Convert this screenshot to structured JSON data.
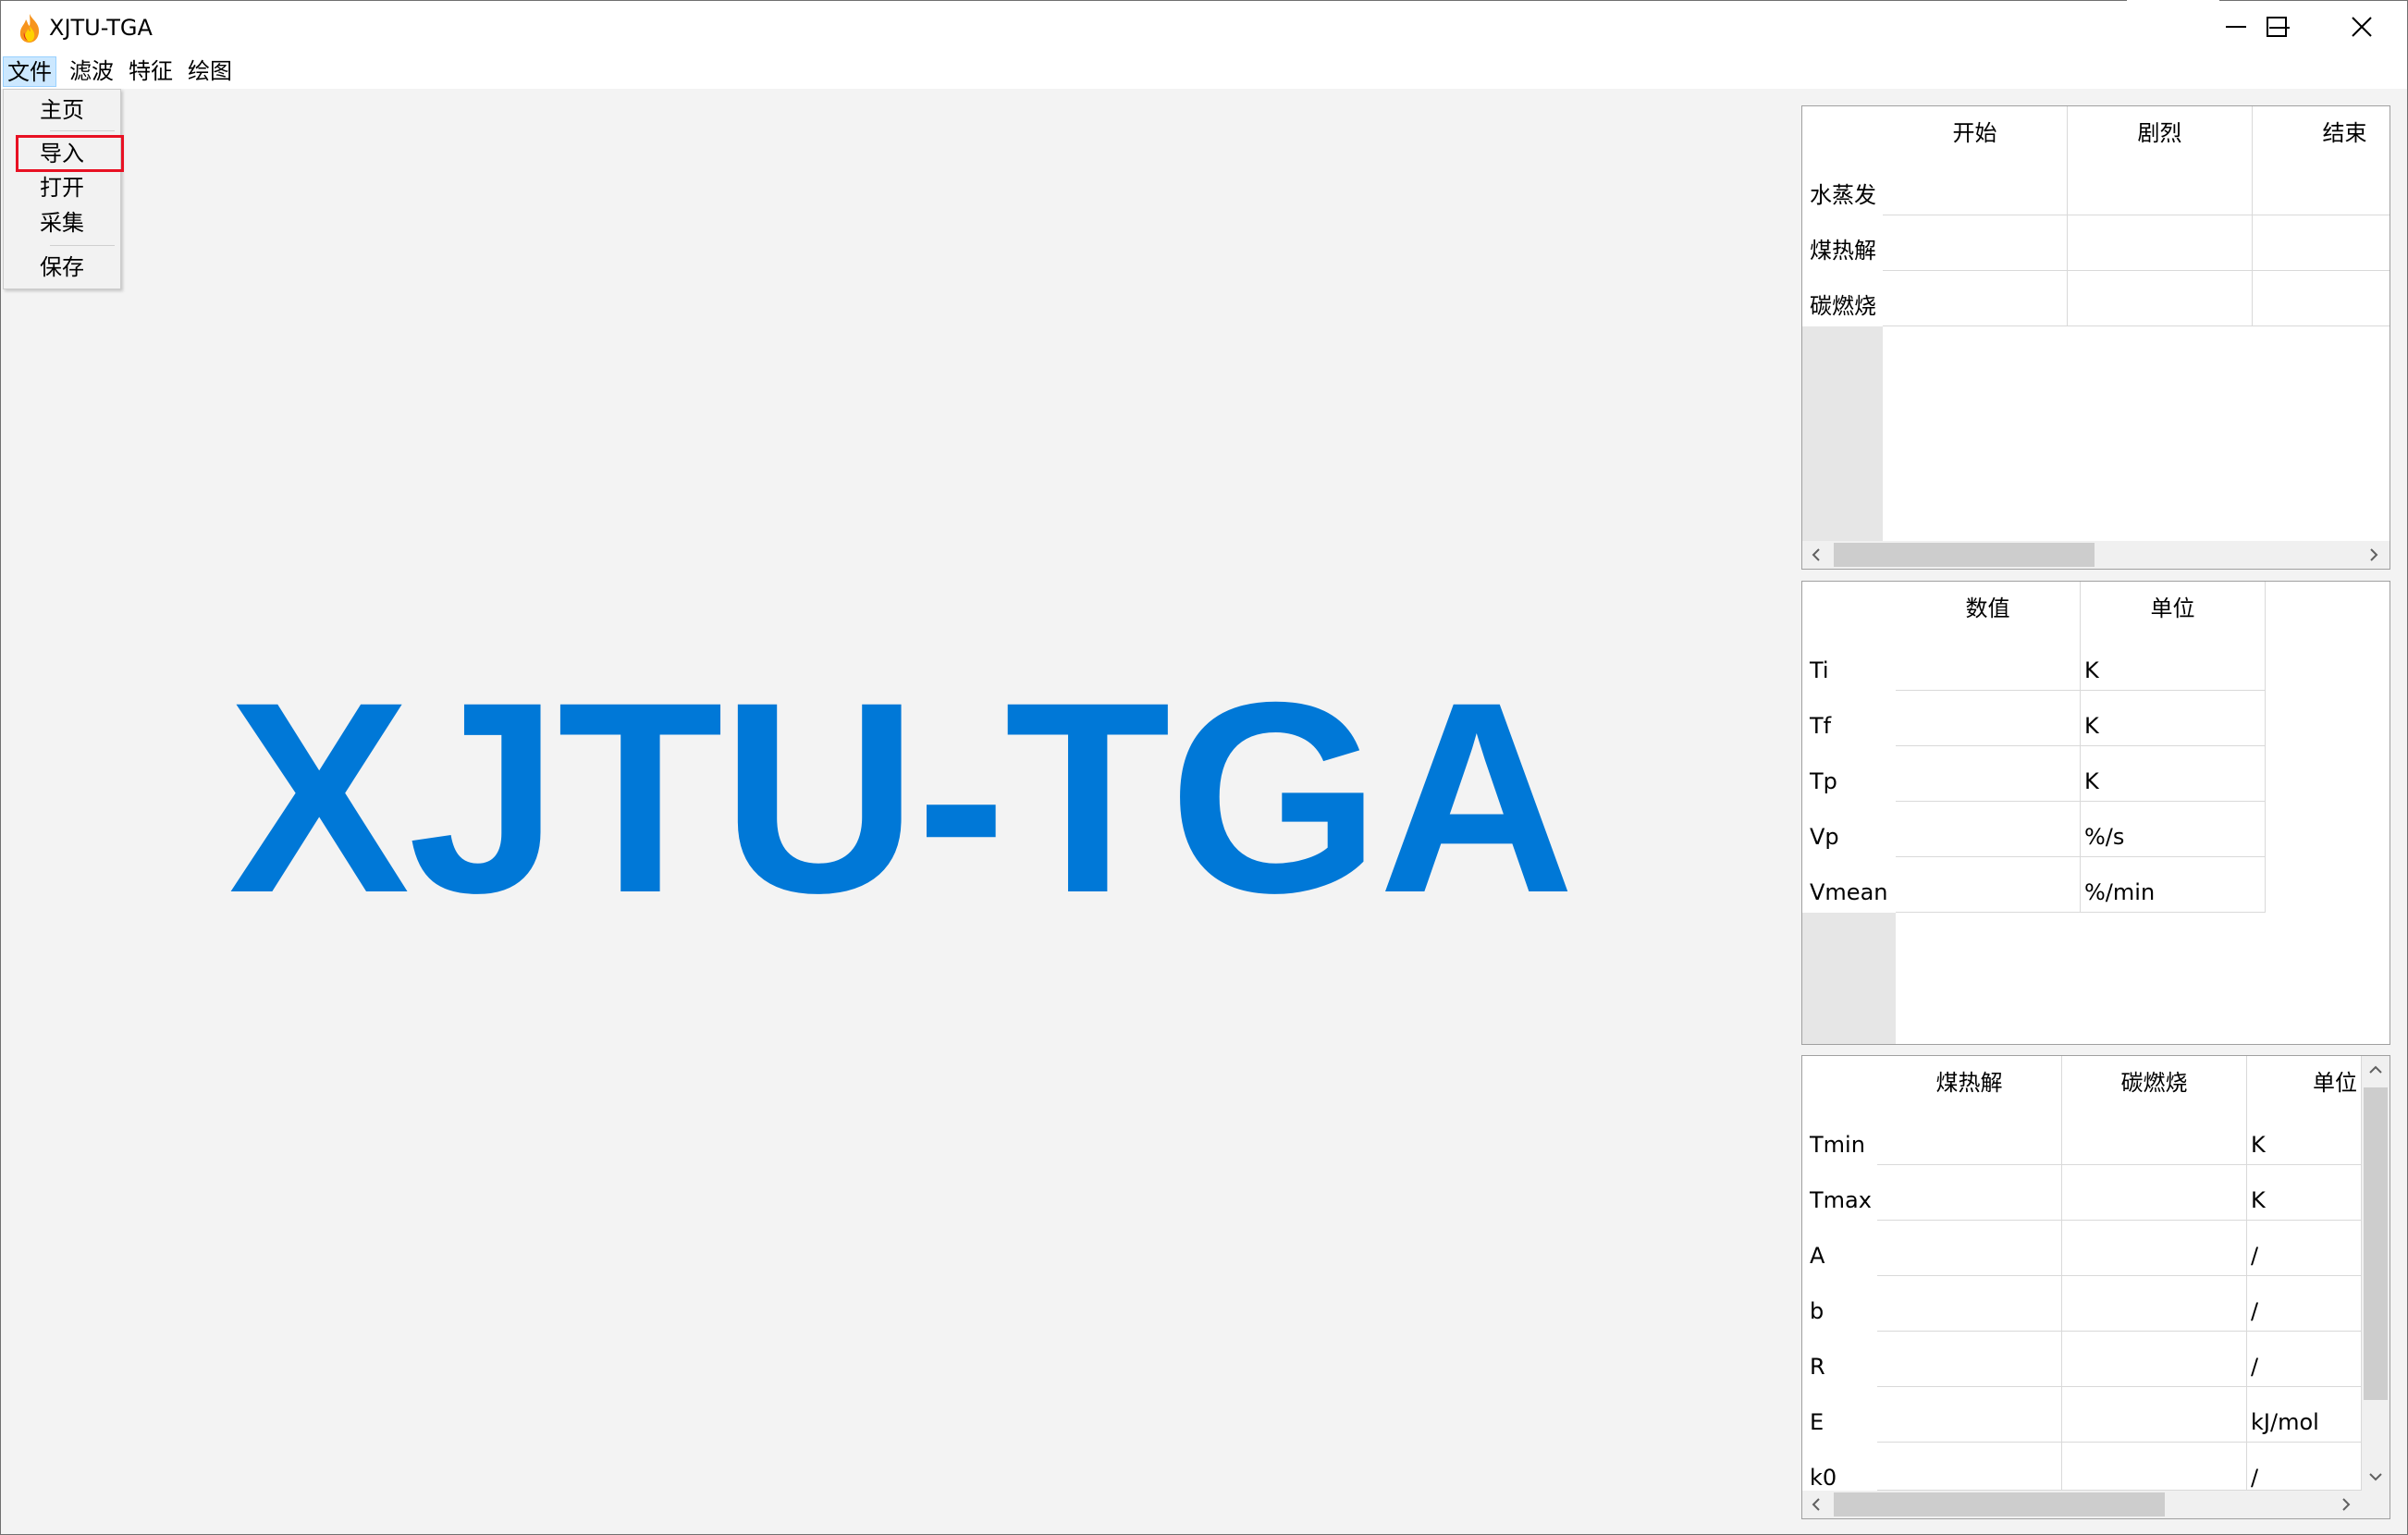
{
  "window": {
    "title": "XJTU-TGA"
  },
  "menubar": {
    "items": [
      "文件",
      "滤波",
      "特征",
      "绘图"
    ]
  },
  "file_menu": {
    "items": [
      "主页",
      "导入",
      "打开",
      "采集",
      "保存"
    ]
  },
  "main": {
    "logo_text": "XJTU-TGA",
    "logo_color": "#0078d7"
  },
  "stage_table": {
    "columns": [
      "开始",
      "剧烈",
      "结束"
    ],
    "rows": [
      "水蒸发",
      "煤热解",
      "碳燃烧"
    ]
  },
  "feature_table": {
    "columns": [
      "数值",
      "单位"
    ],
    "rows": [
      {
        "name": "Ti",
        "unit": "K"
      },
      {
        "name": "Tf",
        "unit": "K"
      },
      {
        "name": "Tp",
        "unit": "K"
      },
      {
        "name": "Vp",
        "unit": "%/s"
      },
      {
        "name": "Vmean",
        "unit": "%/min"
      }
    ]
  },
  "kinetics_table": {
    "columns": [
      "煤热解",
      "碳燃烧",
      "单位"
    ],
    "rows": [
      {
        "name": "Tmin",
        "unit": "K"
      },
      {
        "name": "Tmax",
        "unit": "K"
      },
      {
        "name": "A",
        "unit": "/"
      },
      {
        "name": "b",
        "unit": "/"
      },
      {
        "name": "R",
        "unit": "/"
      },
      {
        "name": "E",
        "unit": "kJ/mol"
      },
      {
        "name": "k0",
        "unit": "/"
      }
    ]
  },
  "icons": {
    "app": "flame-icon",
    "minimize": "minimize-icon",
    "maximize": "maximize-icon",
    "close": "close-icon"
  },
  "colors": {
    "accent": "#0078d7",
    "highlight_box": "#e81123",
    "menu_active": "#cce8ff"
  }
}
